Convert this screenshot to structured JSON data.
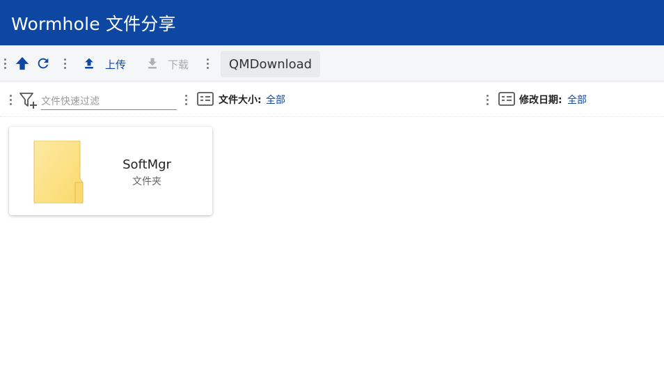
{
  "header": {
    "title": "Wormhole 文件分享"
  },
  "toolbar": {
    "upload_label": "上传",
    "download_label": "下载",
    "breadcrumb": "QMDownload"
  },
  "filter": {
    "placeholder": "文件快速过滤",
    "size_label": "文件大小:",
    "size_value": "全部",
    "date_label": "修改日期:",
    "date_value": "全部"
  },
  "files": [
    {
      "name": "SoftMgr",
      "type": "文件夹",
      "icon": "folder-icon"
    }
  ],
  "colors": {
    "header": "#0d47a1",
    "accent": "#0d47a1",
    "folder": "#fde58a"
  }
}
